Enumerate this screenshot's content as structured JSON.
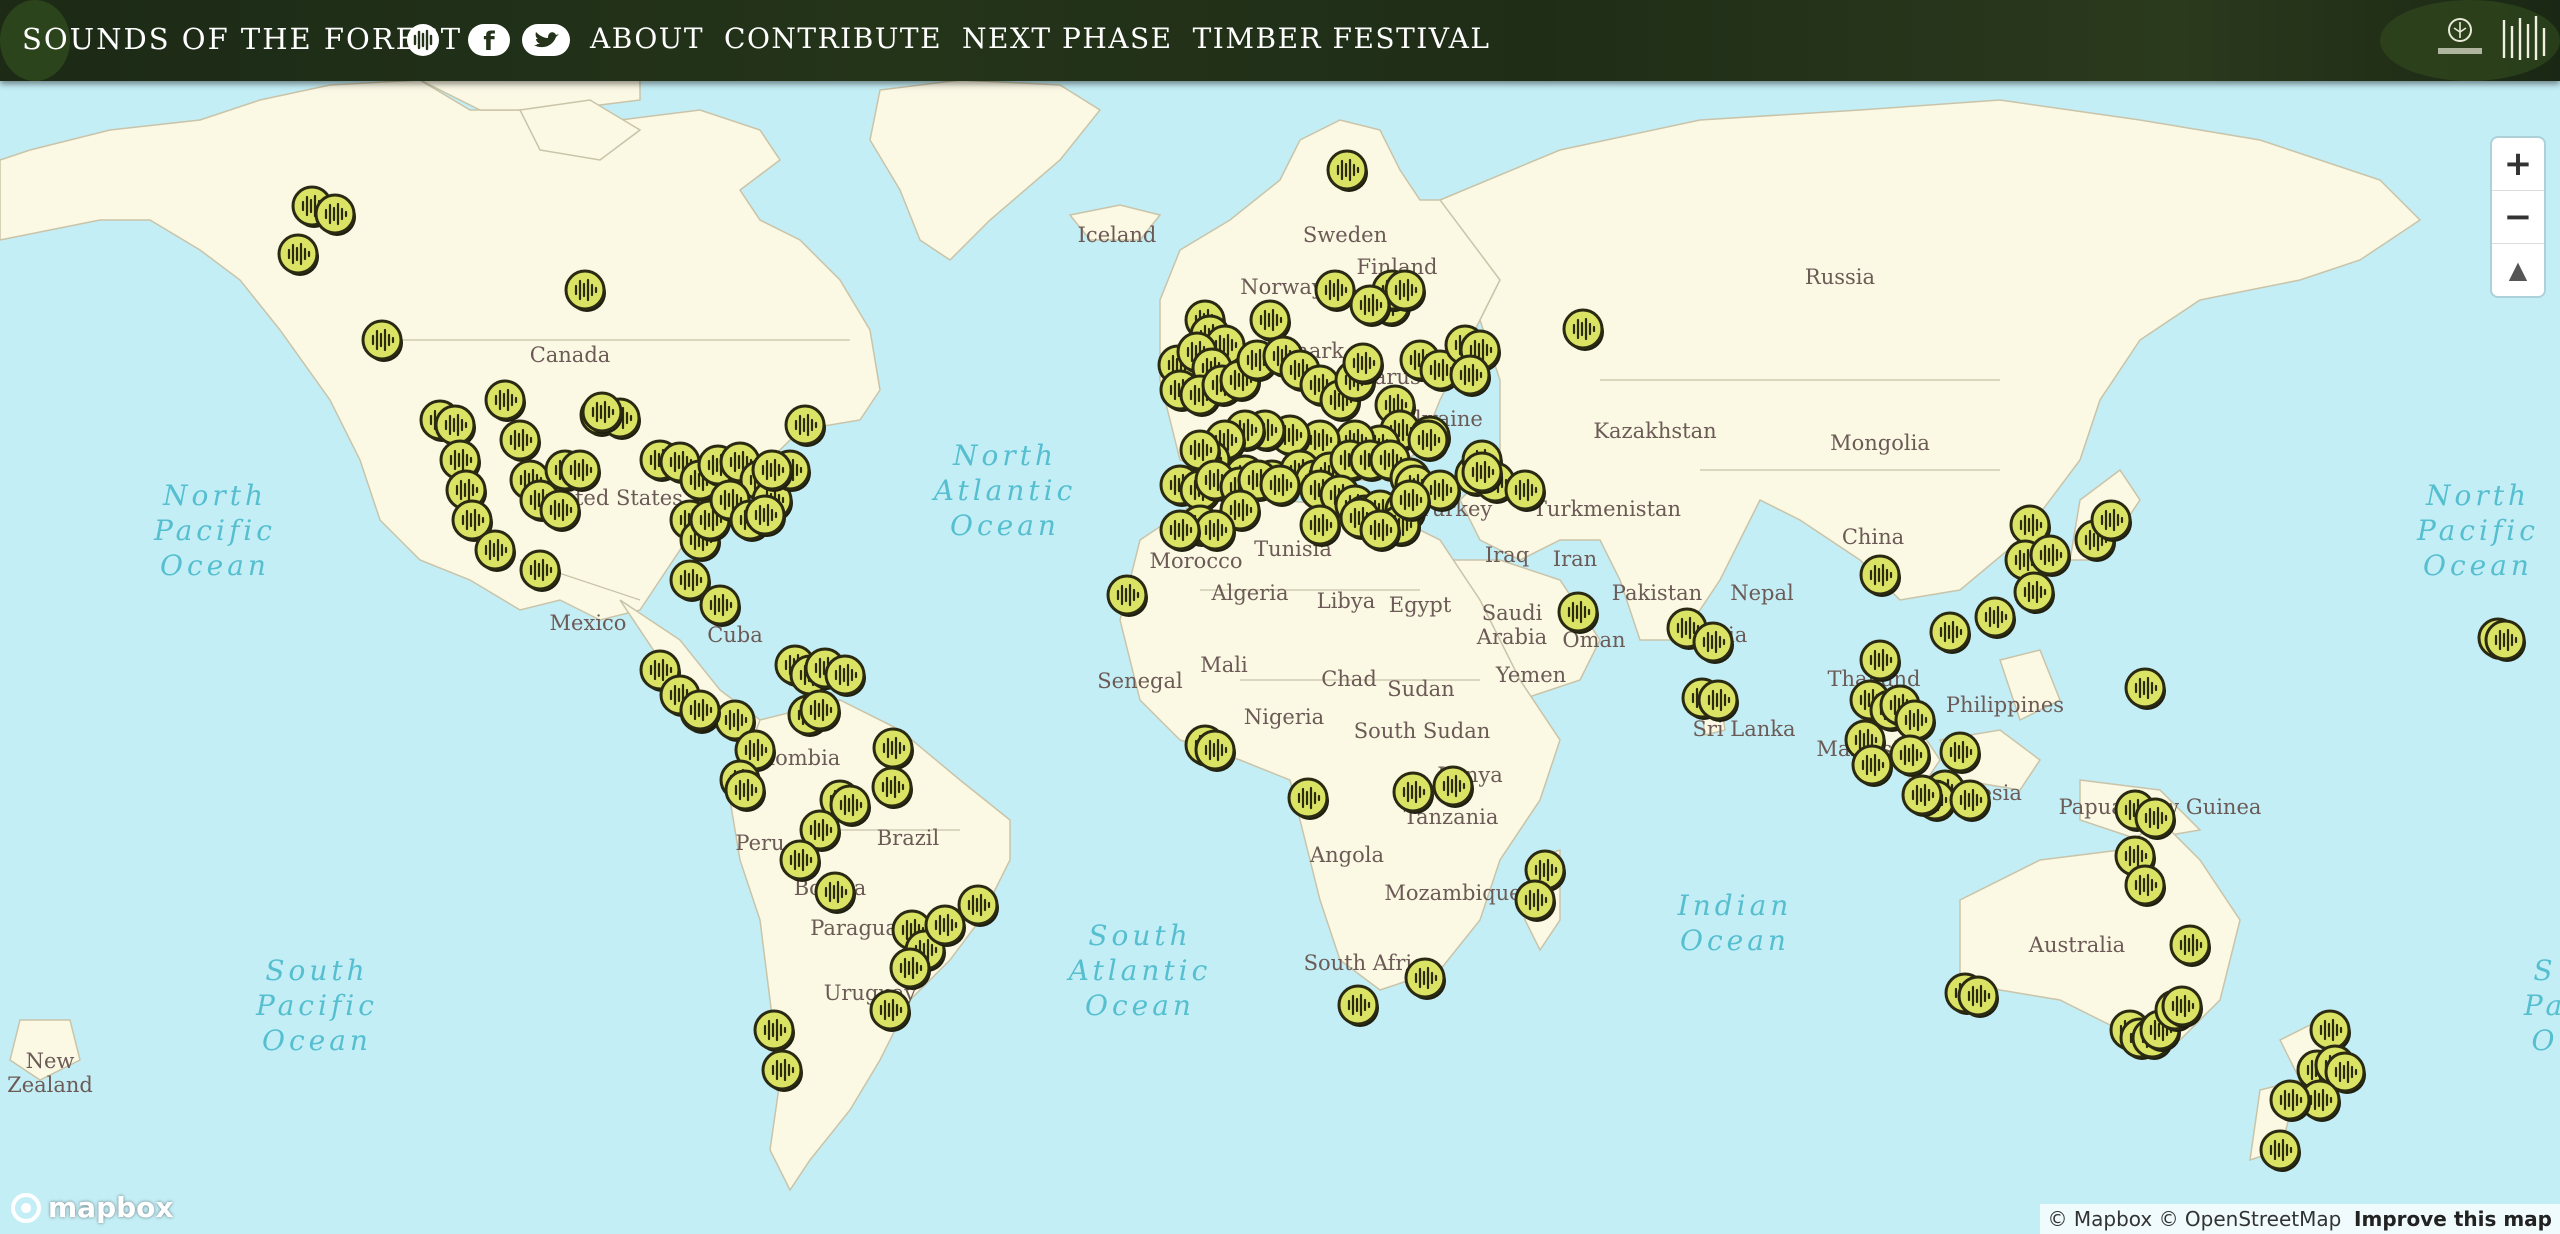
{
  "header": {
    "brand": "SOUNDS OF THE FOREST",
    "nav": [
      "ABOUT",
      "CONTRIBUTE",
      "NEXT PHASE",
      "TIMBER FESTIVAL"
    ],
    "icons": [
      "sound-wave-icon",
      "facebook-icon",
      "twitter-icon"
    ]
  },
  "map": {
    "oceans": [
      {
        "lines": [
          "North",
          "Pacific",
          "Ocean"
        ]
      },
      {
        "lines": [
          "North",
          "Atlantic",
          "Ocean"
        ]
      },
      {
        "lines": [
          "South",
          "Pacific",
          "Ocean"
        ]
      },
      {
        "lines": [
          "South",
          "Atlantic",
          "Ocean"
        ]
      },
      {
        "lines": [
          "Indian",
          "Ocean"
        ]
      },
      {
        "lines": [
          "North",
          "Pacific",
          "Ocean"
        ]
      },
      {
        "lines": [
          "S",
          "Pa",
          "O"
        ]
      }
    ],
    "labels": [
      "Iceland",
      "Sweden",
      "Finland",
      "Norway",
      "Denmark",
      "Belarus",
      "Ukraine",
      "Russia",
      "Kazakhstan",
      "Mongolia",
      "Canada",
      "United States",
      "Mexico",
      "Cuba",
      "Colombia",
      "Peru",
      "Brazil",
      "Bolivia",
      "Paraguay",
      "Uruguay",
      "Morocco",
      "Algeria",
      "Libya",
      "Egypt",
      "Tunisia",
      "Turkey",
      "Turkmenistan",
      "Iraq",
      "Iran",
      "Saudi Arabia",
      "Oman",
      "Yemen",
      "Pakistan",
      "Nepal",
      "India",
      "Sri Lanka",
      "China",
      "Thailand",
      "Malaysia",
      "Indonesia",
      "Philippines",
      "Papua New Guinea",
      "Australia",
      "New Zealand",
      "Senegal",
      "Mali",
      "Chad",
      "Sudan",
      "Nigeria",
      "South Sudan",
      "Kenya",
      "Tanzania",
      "Angola",
      "Mozambique",
      "South Africa"
    ],
    "zoom": {
      "in": "+",
      "out": "−",
      "compass": "▲"
    }
  },
  "footer": {
    "logo": "mapbox",
    "attribution": "© Mapbox © OpenStreetMap",
    "improve": "Improve this map"
  }
}
